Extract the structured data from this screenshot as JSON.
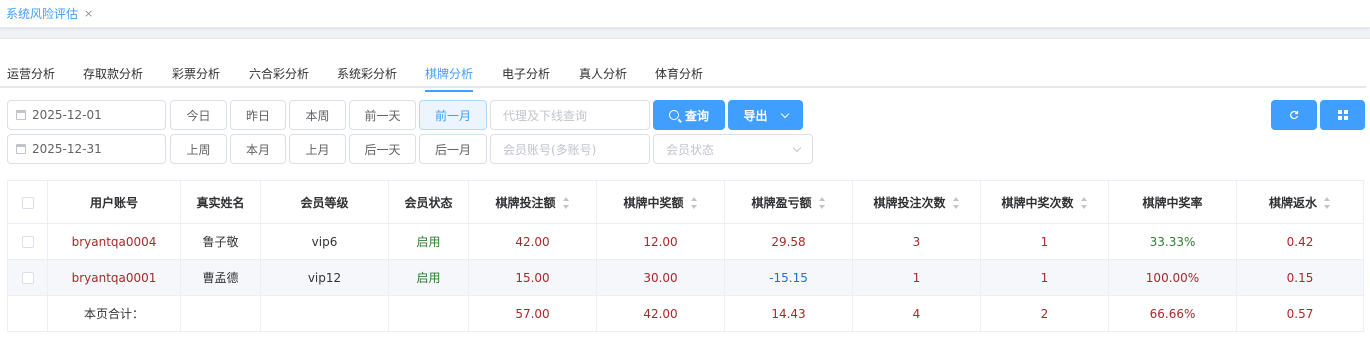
{
  "tab_tag": {
    "label": "系统风险评估",
    "close": "×"
  },
  "tabs": [
    "运营分析",
    "存取款分析",
    "彩票分析",
    "六合彩分析",
    "系统彩分析",
    "棋牌分析",
    "电子分析",
    "真人分析",
    "体育分析"
  ],
  "active_tab": "棋牌分析",
  "filters": {
    "start_date": "2025-12-01",
    "end_date": "2025-12-31",
    "quick_row1": [
      "今日",
      "昨日",
      "本周",
      "前一天",
      "前一月"
    ],
    "quick_row2": [
      "上周",
      "本月",
      "上月",
      "后一天",
      "后一月"
    ],
    "agent_placeholder": "代理及下线查询",
    "member_placeholder": "会员账号(多账号)",
    "status_placeholder": "会员状态",
    "search_label": "查询",
    "export_label": "导出"
  },
  "table": {
    "headers": [
      "用户账号",
      "真实姓名",
      "会员等级",
      "会员状态",
      "棋牌投注额",
      "棋牌中奖额",
      "棋牌盈亏额",
      "棋牌投注次数",
      "棋牌中奖次数",
      "棋牌中奖率",
      "棋牌返水"
    ],
    "rows": [
      [
        "bryantqa0004",
        "鲁子敬",
        "vip6",
        "启用",
        "42.00",
        "12.00",
        "29.58",
        "3",
        "1",
        "33.33%",
        "0.42"
      ],
      [
        "bryantqa0001",
        "曹孟德",
        "vip12",
        "启用",
        "15.00",
        "30.00",
        "-15.15",
        "1",
        "1",
        "100.00%",
        "0.15"
      ]
    ],
    "total": [
      "本页合计：",
      "",
      "",
      "",
      "57.00",
      "42.00",
      "14.43",
      "4",
      "2",
      "66.66%",
      "0.57"
    ]
  }
}
